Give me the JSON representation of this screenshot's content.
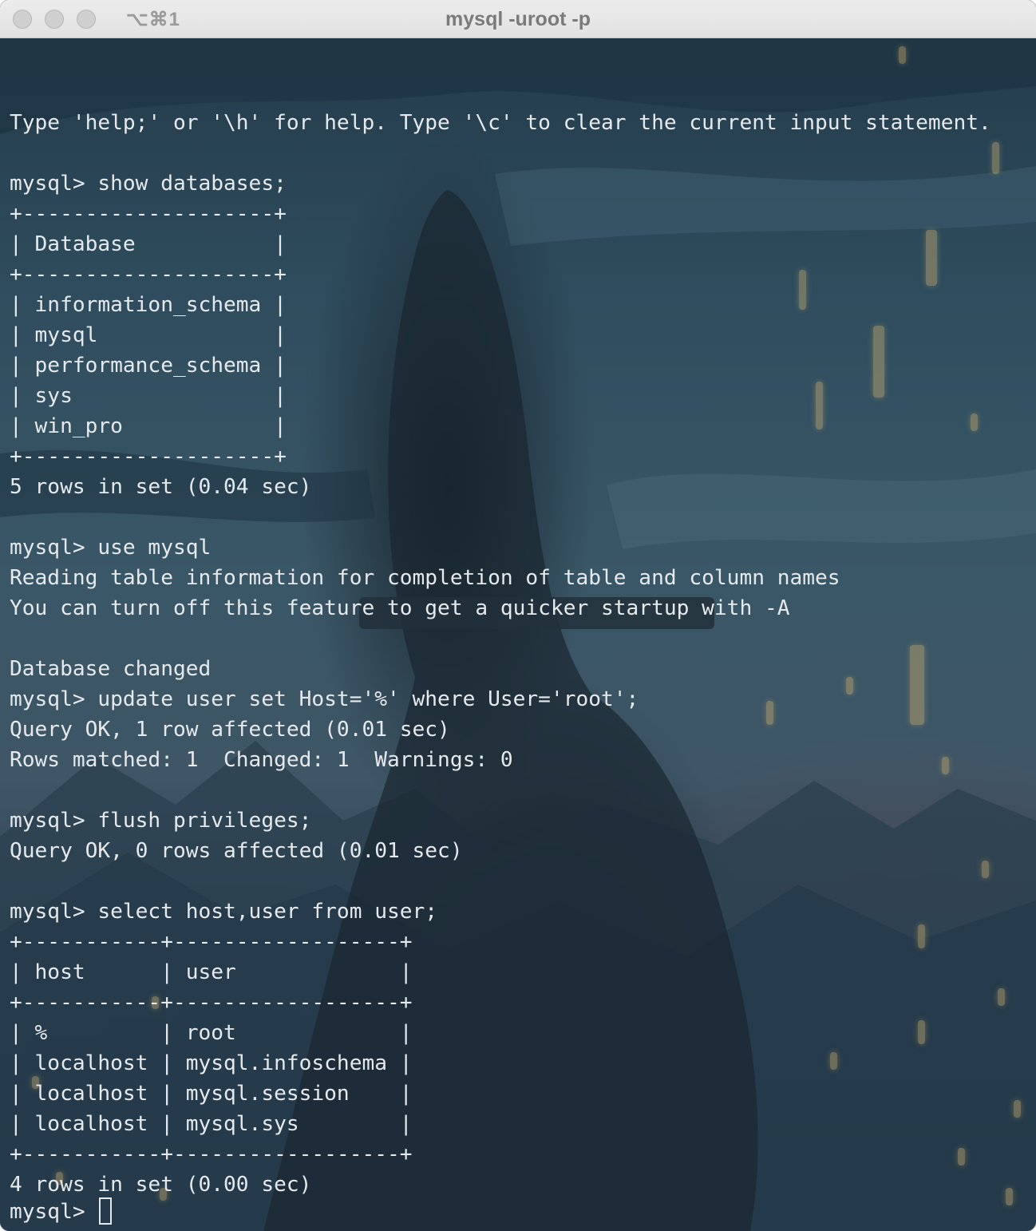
{
  "window": {
    "title": "mysql -uroot -p",
    "tab_shortcut": "⌥⌘1"
  },
  "terminal": {
    "lines": [
      "",
      "Type 'help;' or '\\h' for help. Type '\\c' to clear the current input statement.",
      "",
      "mysql> show databases;",
      "+--------------------+",
      "| Database           |",
      "+--------------------+",
      "| information_schema |",
      "| mysql              |",
      "| performance_schema |",
      "| sys                |",
      "| win_pro            |",
      "+--------------------+",
      "5 rows in set (0.04 sec)",
      "",
      "mysql> use mysql",
      "Reading table information for completion of table and column names",
      "You can turn off this feature to get a quicker startup with -A",
      "",
      "Database changed",
      "mysql> update user set Host='%' where User='root';",
      "Query OK, 1 row affected (0.01 sec)",
      "Rows matched: 1  Changed: 1  Warnings: 0",
      "",
      "mysql> flush privileges;",
      "Query OK, 0 rows affected (0.01 sec)",
      "",
      "mysql> select host,user from user;",
      "+-----------+------------------+",
      "| host      | user             |",
      "+-----------+------------------+",
      "| %         | root             |",
      "| localhost | mysql.infoschema |",
      "| localhost | mysql.session    |",
      "| localhost | mysql.sys        |",
      "+-----------+------------------+",
      "4 rows in set (0.00 sec)",
      ""
    ],
    "prompt": "mysql> "
  },
  "colors": {
    "text": "#e6e9ec",
    "titlebar": "#e6e6e6",
    "background": "#2f4a5a"
  }
}
